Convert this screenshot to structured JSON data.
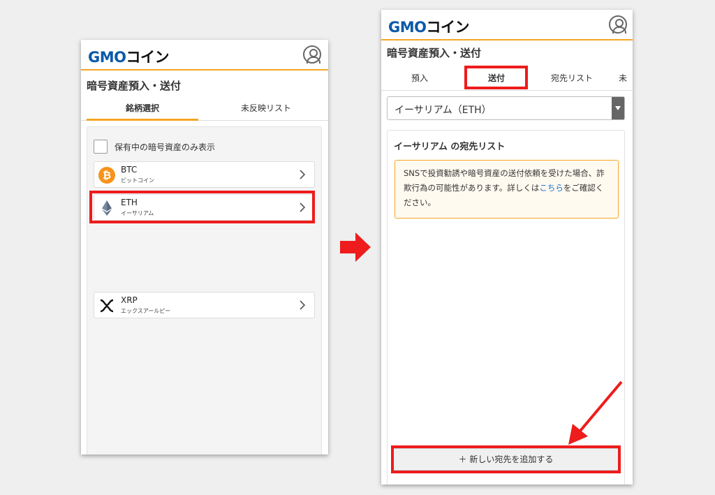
{
  "left": {
    "logo": {
      "brand": "GMO",
      "kana": "コイン"
    },
    "title": "暗号資産預入・送付",
    "tabs": [
      {
        "label": "銘柄選択"
      },
      {
        "label": "未反映リスト"
      }
    ],
    "checkbox_label": "保有中の暗号資産のみ表示",
    "coins": [
      {
        "symbol": "BTC",
        "name": "ビットコイン",
        "icon": "bitcoin-icon"
      },
      {
        "symbol": "ETH",
        "name": "イーサリアム",
        "icon": "ethereum-icon"
      },
      {
        "symbol": "XRP",
        "name": "エックスアールピー",
        "icon": "xrp-icon"
      }
    ]
  },
  "right": {
    "logo": {
      "brand": "GMO",
      "kana": "コイン"
    },
    "title": "暗号資産預入・送付",
    "tabs": [
      {
        "label": "預入"
      },
      {
        "label": "送付"
      },
      {
        "label": "宛先リスト"
      },
      {
        "label": "未"
      }
    ],
    "select_value": "イーサリアム（ETH）",
    "panel_title": "イーサリアム の宛先リスト",
    "warning_text": "SNSで投資勧誘や暗号資産の送付依頼を受けた場合、詐欺行為の可能性があります。詳しくは",
    "warning_link": "こちら",
    "warning_end": "をご確認ください。",
    "add_button": "＋ 新しい宛先を追加する"
  },
  "colors": {
    "accent": "#f5a623",
    "highlight": "#ee1c1c",
    "logo_blue": "#0a5aa9",
    "link": "#1a6fd0"
  }
}
